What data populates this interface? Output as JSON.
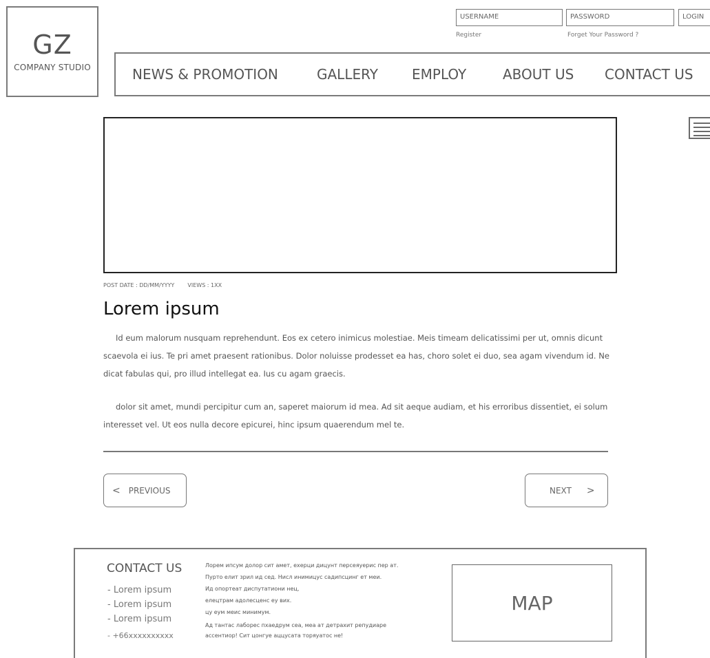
{
  "logo": {
    "mark": "GZ",
    "subtitle": "COMPANY STUDIO"
  },
  "login": {
    "username_placeholder": "USERNAME",
    "password_placeholder": "PASSWORD",
    "login_label": "LOGIN",
    "register_label": "Register",
    "forgot_label": "Forget Your Password ?"
  },
  "nav": {
    "items": [
      {
        "label": "NEWS & PROMOTION"
      },
      {
        "label": "GALLERY"
      },
      {
        "label": "EMPLOY"
      },
      {
        "label": "ABOUT US"
      },
      {
        "label": "CONTACT US"
      }
    ]
  },
  "menu_icon": "hamburger-menu-icon",
  "article": {
    "post_date_label": "POST DATE : DD/MM/YYYY",
    "views_label": "VIEWS : 1XX",
    "title": "Lorem ipsum",
    "paragraphs": [
      "Id eum malorum nusquam reprehendunt. Eos ex cetero inimicus molestiae. Meis timeam delicatissimi per ut, omnis dicunt scaevola ei ius. Te pri amet praesent rationibus. Dolor noluisse prodesset ea has, choro solet ei duo, sea agam vivendum id. Ne dicat fabulas qui, pro illud intellegat ea. Ius cu agam graecis.",
      "dolor sit amet, mundi percipitur cum an, saperet maiorum id mea. Ad sit aeque audiam, et his erroribus dissentiet, ei solum interesset vel. Ut eos nulla decore epicurei, hinc ipsum quaerendum mel te."
    ]
  },
  "pager": {
    "prev_icon": "<",
    "prev_label": "PREVIOUS",
    "next_label": "NEXT",
    "next_icon": ">"
  },
  "footer": {
    "contact_title": "CONTACT US",
    "contact_items": [
      "- Lorem ipsum",
      "- Lorem ipsum",
      "- Lorem ipsum",
      "- +66xxxxxxxxxx"
    ],
    "text_lines": [
      "Лорем ипсум долор сит амет, ехерци дицунт персеяуерис пер ат.",
      "Пурто елит зрил ид сед. Нисл инимицус садипсцинг ет меи.",
      "Ид опортеат диспутатиони нец,",
      "елецтрам адолесценс еу вих.",
      "цу еум меис минимум.",
      "Ад тантас лаборес пхаедрум сеа, меа ат детрахит репудиаре",
      "ассентиор! Сит цонгуе аццусата торяуатос не!"
    ],
    "map_label": "MAP"
  }
}
